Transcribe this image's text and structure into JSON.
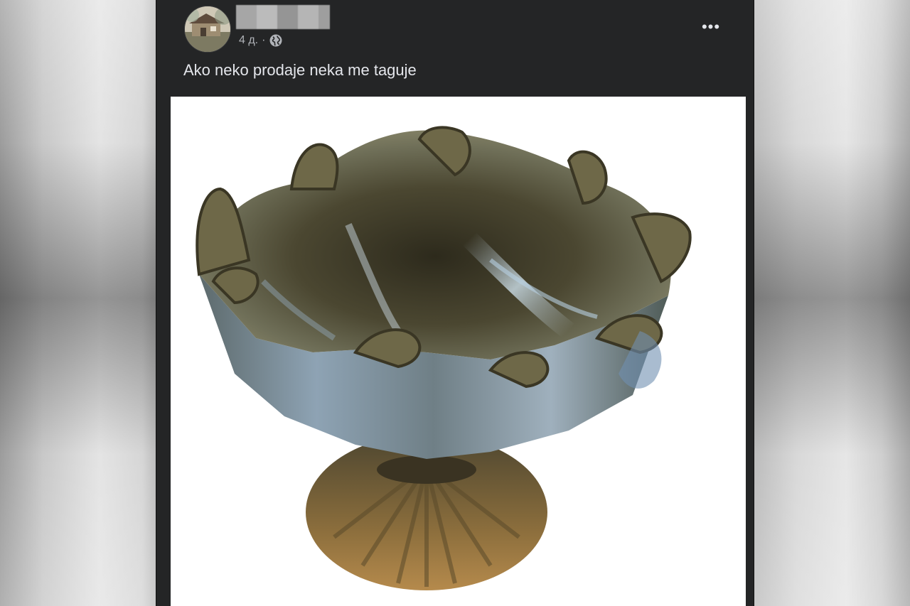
{
  "post": {
    "timestamp": "4 д.",
    "separator": "·",
    "privacy_icon": "globe-icon",
    "more_label": "•••",
    "caption": "Ako neko prodaje neka me taguje",
    "photo_subject": "iridescent glass lotus-shaped footed bowl"
  },
  "colors": {
    "post_bg": "#242526",
    "text_primary": "#e4e6eb",
    "text_secondary": "#b0b3b8"
  }
}
